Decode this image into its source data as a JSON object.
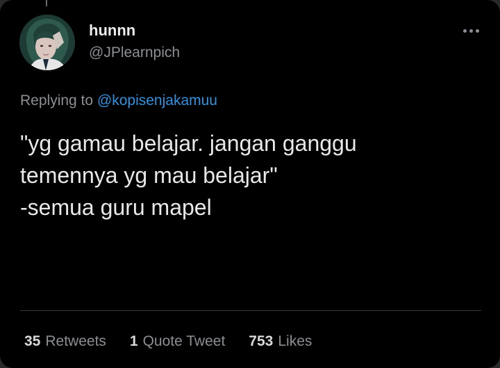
{
  "author": {
    "display_name": "hunnn",
    "handle": "@JPlearnpich"
  },
  "reply": {
    "prefix": "Replying to",
    "mention": "@kopisenjakamuu"
  },
  "tweet": {
    "lines": [
      "\"yg gamau belajar. jangan ganggu",
      "temennya yg mau belajar\"",
      "-semua guru mapel"
    ]
  },
  "stats": [
    {
      "count": "35",
      "label": "Retweets"
    },
    {
      "count": "1",
      "label": "Quote Tweet"
    },
    {
      "count": "753",
      "label": "Likes"
    }
  ],
  "icons": {
    "more": "more-horizontal-icon",
    "avatar": "profile-avatar-image"
  },
  "colors": {
    "background": "#000000",
    "text_primary": "#e8e8e8",
    "text_secondary": "#8b8f93",
    "link": "#2f92e0",
    "divider": "#333536"
  }
}
